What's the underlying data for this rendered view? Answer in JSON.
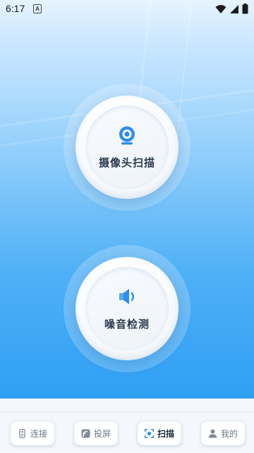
{
  "status_bar": {
    "time": "6:17",
    "notification_letter": "A",
    "icons": [
      "wifi-icon",
      "signal-icon",
      "battery-icon"
    ]
  },
  "main": {
    "buttons": [
      {
        "label": "摄像头扫描",
        "icon": "camera-icon"
      },
      {
        "label": "噪音检测",
        "icon": "speaker-icon"
      }
    ]
  },
  "bottom_nav": {
    "items": [
      {
        "label": "连接",
        "icon": "remote-icon",
        "active": false
      },
      {
        "label": "投屏",
        "icon": "cast-icon",
        "active": false
      },
      {
        "label": "扫描",
        "icon": "scan-icon",
        "active": true
      },
      {
        "label": "我的",
        "icon": "user-icon",
        "active": false
      }
    ]
  },
  "colors": {
    "accent": "#2f8df0",
    "text_dark": "#2b3a4e",
    "nav_inactive": "#6b7a8c"
  }
}
